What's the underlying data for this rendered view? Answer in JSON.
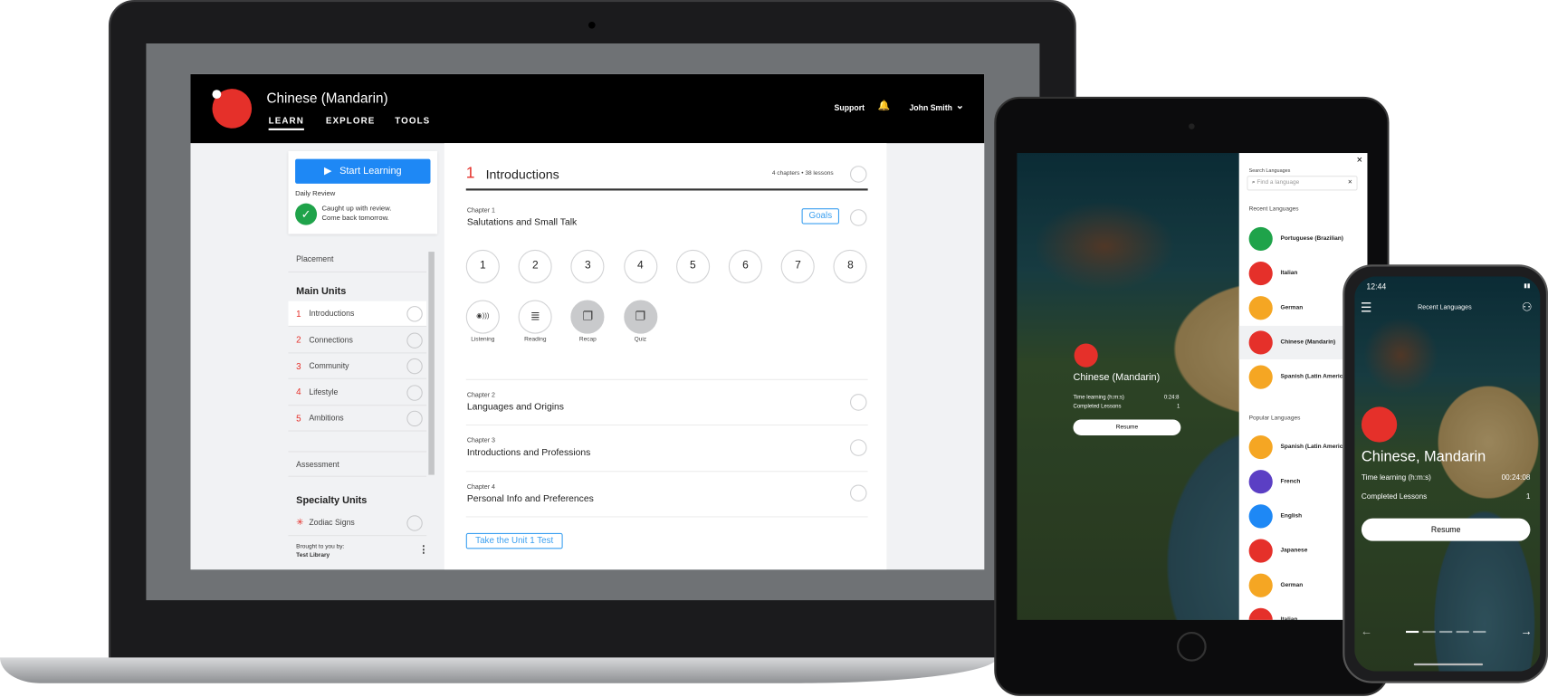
{
  "laptop": {
    "header": {
      "title": "Chinese (Mandarin)",
      "nav": [
        "LEARN",
        "EXPLORE",
        "TOOLS"
      ],
      "support": "Support",
      "user": "John Smith"
    },
    "sidebar": {
      "start_learning": "Start Learning",
      "daily_review": "Daily Review",
      "review_msg_1": "Caught up with review.",
      "review_msg_2": "Come back tomorrow.",
      "placement": "Placement",
      "main_units_title": "Main Units",
      "units": [
        {
          "num": "1",
          "label": "Introductions"
        },
        {
          "num": "2",
          "label": "Connections"
        },
        {
          "num": "3",
          "label": "Community"
        },
        {
          "num": "4",
          "label": "Lifestyle"
        },
        {
          "num": "5",
          "label": "Ambitions"
        }
      ],
      "assessment": "Assessment",
      "specialty_title": "Specialty Units",
      "specialty": [
        {
          "label": "Zodiac Signs"
        }
      ],
      "brought_by": "Brought to you by:",
      "library": "Test Library"
    },
    "main": {
      "unit_num": "1",
      "unit_title": "Introductions",
      "unit_meta": "4 chapters • 38 lessons",
      "chapters": [
        {
          "label": "Chapter 1",
          "title": "Salutations and Small Talk"
        },
        {
          "label": "Chapter 2",
          "title": "Languages and Origins"
        },
        {
          "label": "Chapter 3",
          "title": "Introductions and Professions"
        },
        {
          "label": "Chapter 4",
          "title": "Personal Info and Preferences"
        }
      ],
      "goals": "Goals",
      "lessons": [
        "1",
        "2",
        "3",
        "4",
        "5",
        "6",
        "7",
        "8"
      ],
      "activities": [
        {
          "label": "Listening",
          "icon": "listening-icon"
        },
        {
          "label": "Reading",
          "icon": "reading-icon"
        },
        {
          "label": "Recap",
          "icon": "cards-icon"
        },
        {
          "label": "Quiz",
          "icon": "cards-icon"
        }
      ],
      "test_button": "Take the Unit 1 Test"
    }
  },
  "tablet": {
    "card": {
      "title": "Chinese (Mandarin)",
      "time_label": "Time learning (h:m:s)",
      "time_value": "0:24:8",
      "lessons_label": "Completed Lessons",
      "lessons_value": "1",
      "resume": "Resume"
    },
    "panel": {
      "search_label": "Search Languages",
      "search_placeholder": "Find a language",
      "recent_title": "Recent Languages",
      "recent": [
        {
          "name": "Portuguese (Brazilian)",
          "color": "#1fa34a"
        },
        {
          "name": "Italian",
          "color": "#e5302a"
        },
        {
          "name": "German",
          "color": "#f5a623"
        },
        {
          "name": "Chinese (Mandarin)",
          "color": "#e5302a"
        },
        {
          "name": "Spanish (Latin American)",
          "color": "#f5a623"
        }
      ],
      "popular_title": "Popular Languages",
      "popular": [
        {
          "name": "Spanish (Latin American)",
          "color": "#f5a623"
        },
        {
          "name": "French",
          "color": "#5b3fc4"
        },
        {
          "name": "English",
          "color": "#1e88f5"
        },
        {
          "name": "Japanese",
          "color": "#e5302a"
        },
        {
          "name": "German",
          "color": "#f5a623"
        },
        {
          "name": "Italian",
          "color": "#e5302a"
        }
      ]
    }
  },
  "phone": {
    "time": "12:44",
    "title": "Recent Languages",
    "language": "Chinese, Mandarin",
    "time_label": "Time learning (h:m:s)",
    "time_value": "00:24:08",
    "lessons_label": "Completed Lessons",
    "lessons_value": "1",
    "resume": "Resume",
    "pages": 5,
    "current_page": 1
  },
  "colors": {
    "brand_red": "#e5302a",
    "accent_blue": "#1e88f5",
    "success_green": "#1fa34a"
  }
}
